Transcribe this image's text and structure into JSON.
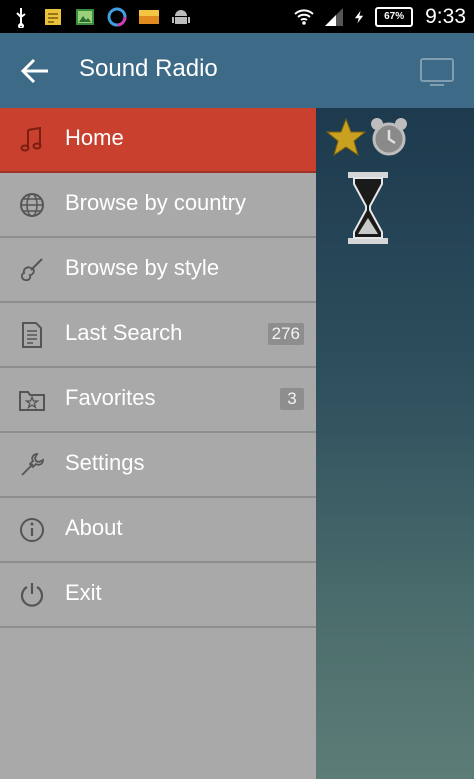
{
  "status_bar": {
    "time": "9:33",
    "battery": "67%",
    "icons": [
      "usb-icon",
      "notes-icon",
      "gallery-icon",
      "sync-icon",
      "weather-icon",
      "android-icon",
      "wifi-icon",
      "signal-icon",
      "charging-icon"
    ]
  },
  "app_bar": {
    "title": "Sound Radio",
    "back_icon": "arrow-left-icon",
    "action_icon": "screen-icon"
  },
  "drawer": {
    "items": [
      {
        "label": "Home",
        "icon": "music-note-icon",
        "active": true
      },
      {
        "label": "Browse by country",
        "icon": "globe-icon"
      },
      {
        "label": "Browse by style",
        "icon": "guitar-icon"
      },
      {
        "label": "Last Search",
        "icon": "document-icon",
        "count": "276"
      },
      {
        "label": "Favorites",
        "icon": "favorites-folder-icon",
        "count": "3"
      },
      {
        "label": "Settings",
        "icon": "wrench-icon"
      },
      {
        "label": "About",
        "icon": "info-icon"
      },
      {
        "label": "Exit",
        "icon": "power-icon"
      }
    ]
  },
  "content": {
    "icons": [
      "star-icon",
      "alarm-clock-icon",
      "hourglass-icon"
    ]
  },
  "colors": {
    "status_bar": "#000000",
    "app_bar": "#3d6a86",
    "drawer": "#a9a9a9",
    "active_item": "#c9402f",
    "divider": "#8e8e8e"
  }
}
